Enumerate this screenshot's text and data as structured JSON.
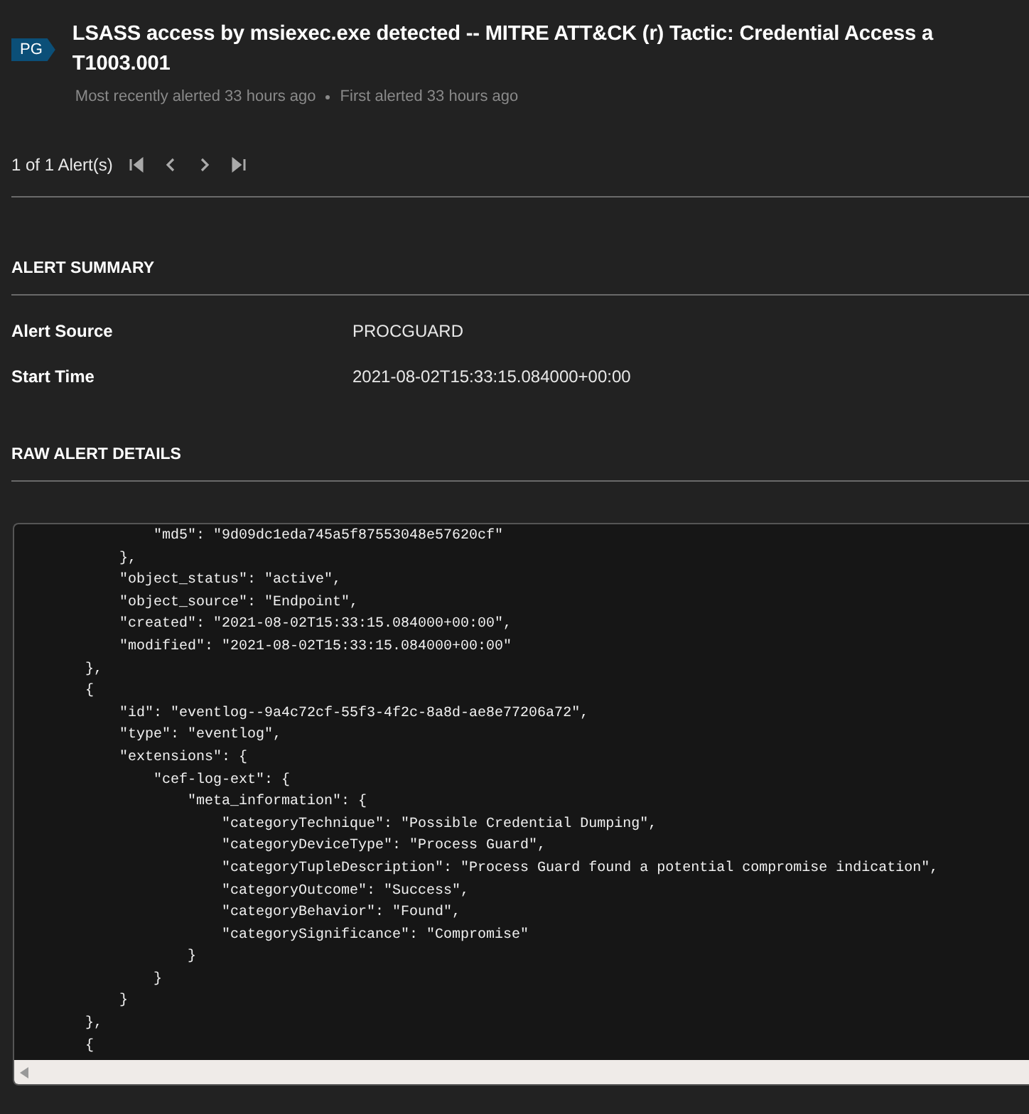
{
  "badge": "PG",
  "title_lines": [
    "LSASS access by msiexec.exe detected -- MITRE ATT&CK (r) Tactic: Credential Access a",
    "T1003.001"
  ],
  "meta": [
    "Most recently alerted 33 hours ago",
    "First alerted 33 hours ago"
  ],
  "pager": {
    "label": "1 of 1 Alert(s)"
  },
  "summary": {
    "heading": "ALERT SUMMARY",
    "rows": [
      {
        "label": "Alert Source",
        "value": "PROCGUARD"
      },
      {
        "label": "Start Time",
        "value": "2021-08-02T15:33:15.084000+00:00"
      }
    ]
  },
  "raw": {
    "heading": "RAW ALERT DETAILS",
    "lines": [
      "                \"md5\": \"9d09dc1eda745a5f87553048e57620cf\"",
      "            },",
      "            \"object_status\": \"active\",",
      "            \"object_source\": \"Endpoint\",",
      "            \"created\": \"2021-08-02T15:33:15.084000+00:00\",",
      "            \"modified\": \"2021-08-02T15:33:15.084000+00:00\"",
      "        },",
      "        {",
      "            \"id\": \"eventlog--9a4c72cf-55f3-4f2c-8a8d-ae8e77206a72\",",
      "            \"type\": \"eventlog\",",
      "            \"extensions\": {",
      "                \"cef-log-ext\": {",
      "                    \"meta_information\": {",
      "                        \"categoryTechnique\": \"Possible Credential Dumping\",",
      "                        \"categoryDeviceType\": \"Process Guard\",",
      "                        \"categoryTupleDescription\": \"Process Guard found a potential compromise indication\",",
      "                        \"categoryOutcome\": \"Success\",",
      "                        \"categoryBehavior\": \"Found\",",
      "                        \"categorySignificance\": \"Compromise\"",
      "                    }",
      "                }",
      "            }",
      "        },",
      "        {"
    ]
  }
}
